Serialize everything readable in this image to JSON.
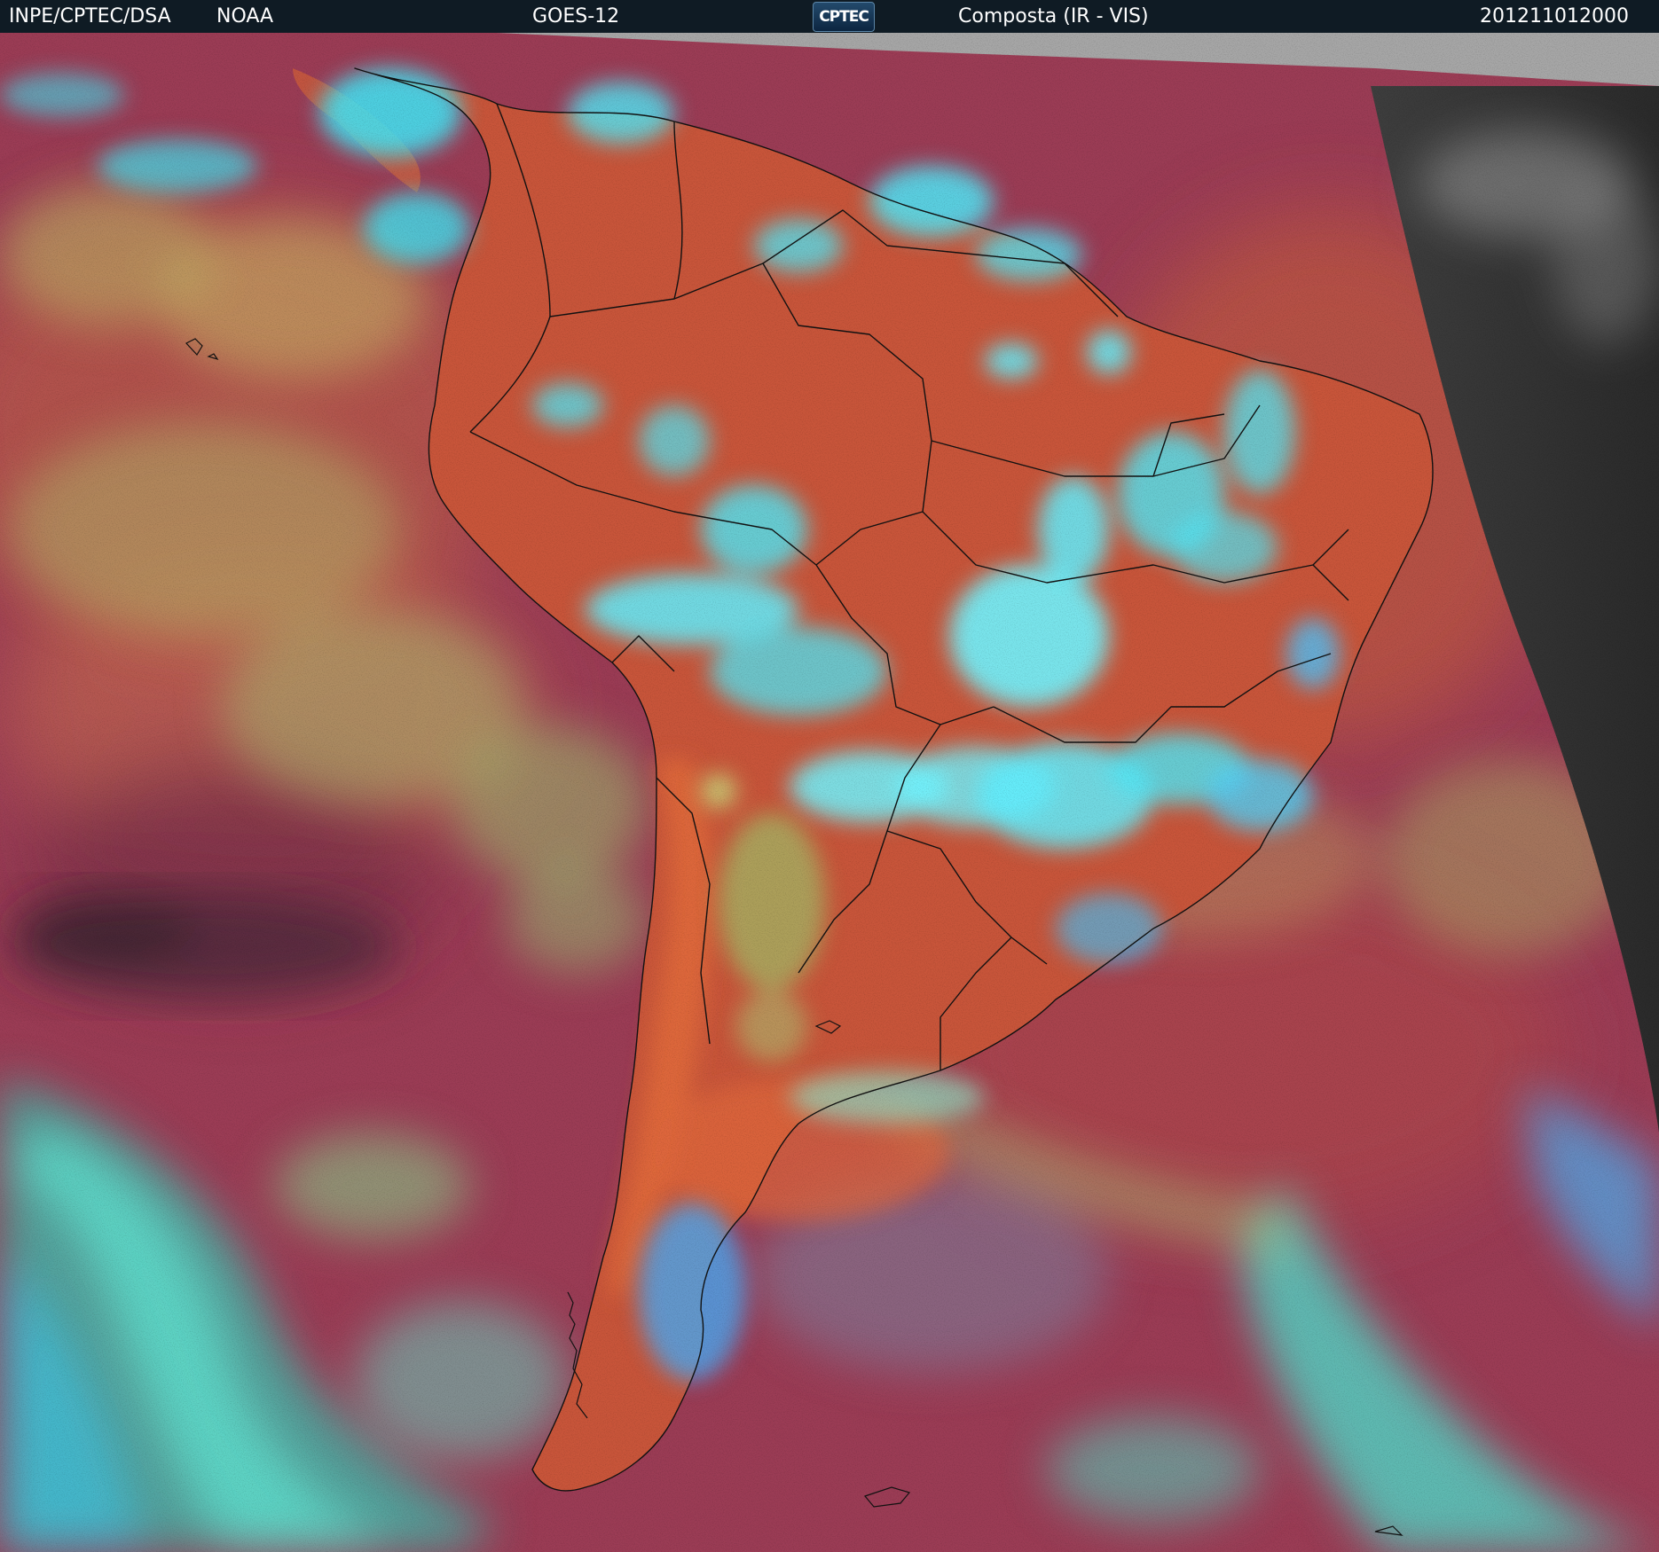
{
  "header": {
    "organization": "INPE/CPTEC/DSA",
    "agency": "NOAA",
    "satellite": "GOES-12",
    "logo_text": "CPTEC",
    "product": "Composta (IR - VIS)",
    "timestamp": "201211012000"
  },
  "colors": {
    "header_bg": "#0f1b24",
    "ocean_magenta": "#9a3a54",
    "land_orange": "#d05a38",
    "cloud_cyan": "#40e8f8",
    "cloud_green": "#9ad070",
    "night_gray": "#3c3c3c",
    "border_lines": "#111111"
  }
}
